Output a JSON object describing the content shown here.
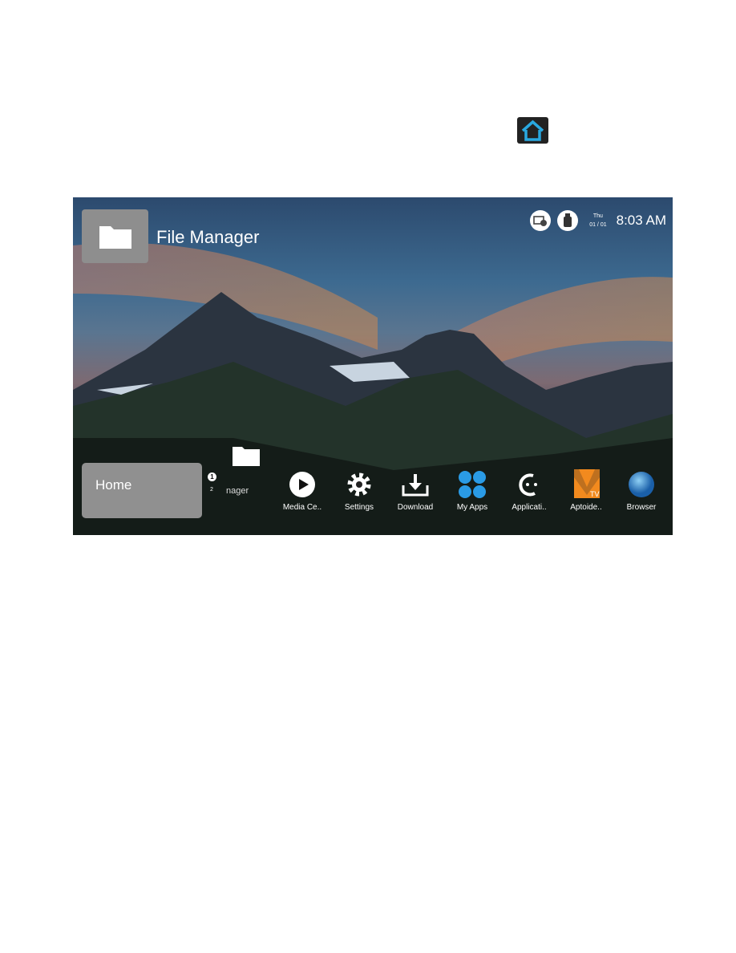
{
  "header": {
    "title": "File Manager"
  },
  "status": {
    "day": "Thu",
    "date": "01 / 01",
    "time": "8:03 AM"
  },
  "home_tile": {
    "label": "Home"
  },
  "focus_item": {
    "badge": "1",
    "index": "2",
    "label": "nager"
  },
  "apps": [
    {
      "label": "Media Ce..",
      "icon": "play-icon"
    },
    {
      "label": "Settings",
      "icon": "gear-icon"
    },
    {
      "label": "Download",
      "icon": "download-icon"
    },
    {
      "label": "My Apps",
      "icon": "apps-grid-icon"
    },
    {
      "label": "Applicati..",
      "icon": "applications-logo-icon"
    },
    {
      "label": "Aptoide..",
      "icon": "aptoide-tv-icon"
    },
    {
      "label": "Browser",
      "icon": "globe-icon"
    }
  ],
  "colors": {
    "home_icon": "#29a8e0",
    "tile": "#8e8e8e",
    "my_apps": "#2a9be6",
    "aptoide": "#f28a1e"
  }
}
